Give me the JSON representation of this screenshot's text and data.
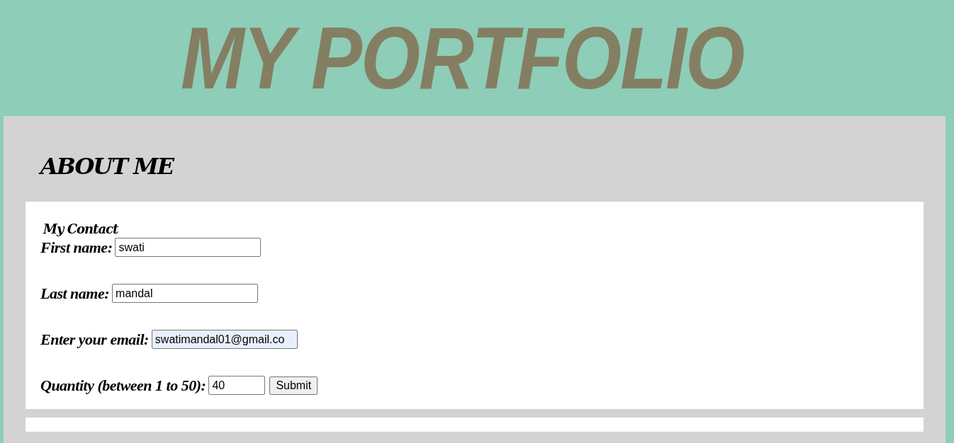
{
  "header": {
    "title": "MY PORTFOLIO"
  },
  "section": {
    "heading": "ABOUT ME"
  },
  "contact_form": {
    "title": "My Contact",
    "fields": [
      {
        "label": "First name:",
        "value": "swati",
        "kind": "text",
        "highlighted": false
      },
      {
        "label": "Last name:",
        "value": "mandal",
        "kind": "text",
        "highlighted": false
      },
      {
        "label": "Enter your email:",
        "value": "swatimandal01@gmail.co",
        "kind": "text",
        "highlighted": true
      },
      {
        "label": "Quantity (between 1 to 50):",
        "value": "40",
        "kind": "number",
        "highlighted": false
      }
    ],
    "submit": "Submit"
  }
}
